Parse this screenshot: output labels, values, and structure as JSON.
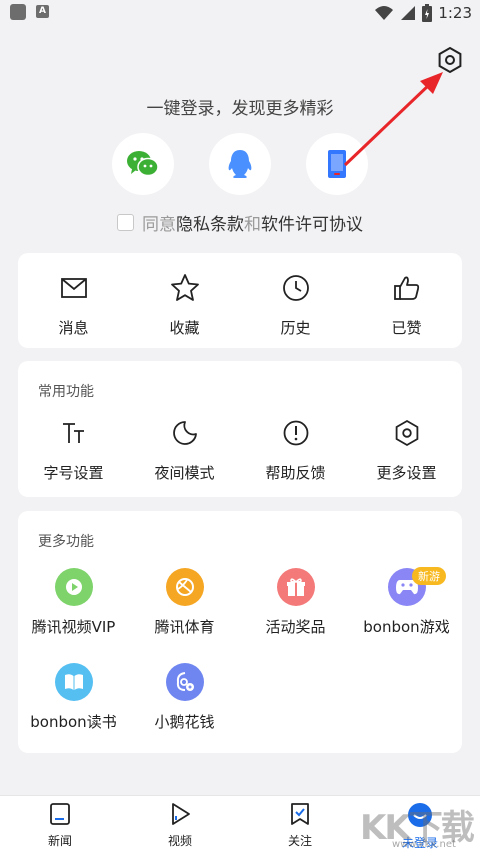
{
  "status_bar": {
    "time": "1:23"
  },
  "login": {
    "prompt": "一键登录，发现更多精彩",
    "methods": [
      {
        "icon": "wechat-icon",
        "color": "#3cb034"
      },
      {
        "icon": "qq-icon",
        "color": "#4a90ff"
      },
      {
        "icon": "phone-icon",
        "color": "#3377ff"
      }
    ],
    "agree_text": "同意",
    "privacy_link": "隐私条款",
    "and_text": "和",
    "license_link": "软件许可协议"
  },
  "quick_actions": [
    {
      "label": "消息",
      "icon": "mail-icon"
    },
    {
      "label": "收藏",
      "icon": "star-icon"
    },
    {
      "label": "历史",
      "icon": "clock-icon"
    },
    {
      "label": "已赞",
      "icon": "thumbs-up-icon"
    }
  ],
  "common_functions": {
    "title": "常用功能",
    "items": [
      {
        "label": "字号设置",
        "icon": "font-size-icon"
      },
      {
        "label": "夜间模式",
        "icon": "moon-icon"
      },
      {
        "label": "帮助反馈",
        "icon": "help-icon"
      },
      {
        "label": "更多设置",
        "icon": "settings-icon"
      }
    ]
  },
  "more_functions": {
    "title": "更多功能",
    "items": [
      {
        "label": "腾讯视频VIP",
        "icon": "video-play-icon",
        "color": "#7ed36b"
      },
      {
        "label": "腾讯体育",
        "icon": "sports-ball-icon",
        "color": "#f5a623"
      },
      {
        "label": "活动奖品",
        "icon": "gift-icon",
        "color": "#f47a7a"
      },
      {
        "label": "bonbon游戏",
        "icon": "gamepad-icon",
        "color": "#8a86f5",
        "badge": "新游"
      },
      {
        "label": "bonbon读书",
        "icon": "book-icon",
        "color": "#55bff2"
      },
      {
        "label": "小鹅花钱",
        "icon": "wallet-icon",
        "color": "#6f86f0"
      }
    ]
  },
  "bottom_nav": [
    {
      "label": "新闻",
      "icon": "news-icon"
    },
    {
      "label": "视频",
      "icon": "video-icon"
    },
    {
      "label": "关注",
      "icon": "follow-icon"
    },
    {
      "label": "未登录",
      "icon": "avatar-icon",
      "active": true
    }
  ],
  "watermark": {
    "text": "KK下载",
    "sub": "www.kkx.net"
  },
  "colors": {
    "accent": "#1a6ce8",
    "arrow": "#e8262a"
  }
}
